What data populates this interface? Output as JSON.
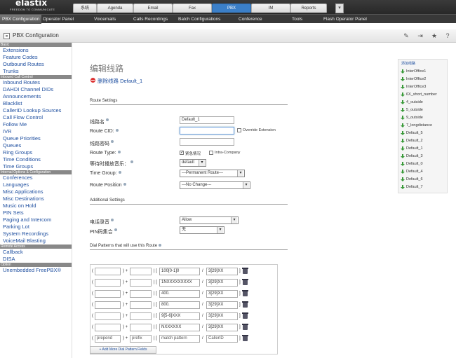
{
  "header": {
    "brand": "elastix",
    "tagline": "FREEDOM TO COMMUNICATE",
    "tabs": [
      "系统",
      "Agenda",
      "Email",
      "Fax",
      "PBX",
      "IM",
      "Reports"
    ],
    "active_tab": "PBX",
    "subnav": [
      "PBX Configuration",
      "Operator Panel",
      "Voicemails",
      "Calls Recordings",
      "Batch Configurations",
      "Conference",
      "Tools",
      "Flash Operator Panel"
    ]
  },
  "module": {
    "title": "PBX Configuration"
  },
  "sidebar": {
    "sections": [
      {
        "title": "Basic",
        "items": [
          "Extensions",
          "Feature Codes",
          "Outbound Routes",
          "Trunks"
        ]
      },
      {
        "title": "Inbound Call Control",
        "items": [
          "Inbound Routes",
          "DAHDI Channel DIDs",
          "Announcements",
          "Blacklist",
          "CallerID Lookup Sources",
          "Call Flow Control",
          "Follow Me",
          "IVR",
          "Queue Priorities",
          "Queues",
          "Ring Groups",
          "Time Conditions",
          "Time Groups"
        ]
      },
      {
        "title": "Internal Options & Configuration",
        "items": [
          "Conferences",
          "Languages",
          "Misc Applications",
          "Misc Destinations",
          "Music on Hold",
          "PIN Sets",
          "Paging and Intercom",
          "Parking Lot",
          "System Recordings",
          "VoiceMail Blasting"
        ]
      },
      {
        "title": "Remote Access",
        "items": [
          "Callback",
          "DISA"
        ]
      },
      {
        "title": "Option",
        "items": [
          "Unembedded FreePBX®"
        ]
      }
    ]
  },
  "main": {
    "title": "编辑线路",
    "delete_label": "删除线路 Default_1",
    "route_settings": {
      "heading": "Route Settings",
      "route_name_label": "线路名",
      "route_name_value": "Default_1",
      "route_cid_label": "Route CID:",
      "route_cid_value": "",
      "override_label": "Override Extension",
      "password_label": "线路密码",
      "password_value": "",
      "route_type_label": "Route Type:",
      "emergency_label": "紧急情况",
      "intra_label": "Intra-Company",
      "moh_label": "等待时播放音乐：",
      "moh_value": "default",
      "time_group_label": "Time Group:",
      "time_group_value": "---Permanent Route---",
      "position_label": "Route Position",
      "position_value": "---No Change---"
    },
    "additional_settings": {
      "heading": "Additional Settings",
      "recording_label": "电话录音",
      "recording_value": "Allow",
      "pinset_label": "PIN码集合",
      "pinset_value": "无"
    },
    "dial_patterns": {
      "heading": "Dial Patterns that will use this Route",
      "rows": [
        {
          "prepend": "",
          "prefix": "",
          "match": "100[0-1]0",
          "callerid": "3[29]XX"
        },
        {
          "prepend": "",
          "prefix": "",
          "match": "1NXXXXXXXXX",
          "callerid": "3[29]XX"
        },
        {
          "prepend": "",
          "prefix": "",
          "match": "400.",
          "callerid": "3[29]XX"
        },
        {
          "prepend": "",
          "prefix": "",
          "match": "800.",
          "callerid": "3[29]XX"
        },
        {
          "prepend": "",
          "prefix": "",
          "match": "9[5-6]XXX",
          "callerid": "3[29]XX"
        },
        {
          "prepend": "",
          "prefix": "",
          "match": "NXXXXXX",
          "callerid": "3[29]XX"
        }
      ],
      "placeholder_row": {
        "prepend": "prepend",
        "prefix": "prefix",
        "match": "match pattern",
        "callerid": "CallerID"
      },
      "add_more_label": "+ Add More Dial Pattern Fields"
    }
  },
  "route_list": {
    "heading": "添加线路",
    "routes": [
      "InterOffice1",
      "InterOffice2",
      "InterOffice3",
      "6X_short_number",
      "4_outside",
      "5_outside",
      "9_outside",
      "7_longdistance",
      "Default_5",
      "Default_2",
      "Default_1",
      "Default_3",
      "Default_0",
      "Default_4",
      "Default_6",
      "Default_7"
    ]
  }
}
